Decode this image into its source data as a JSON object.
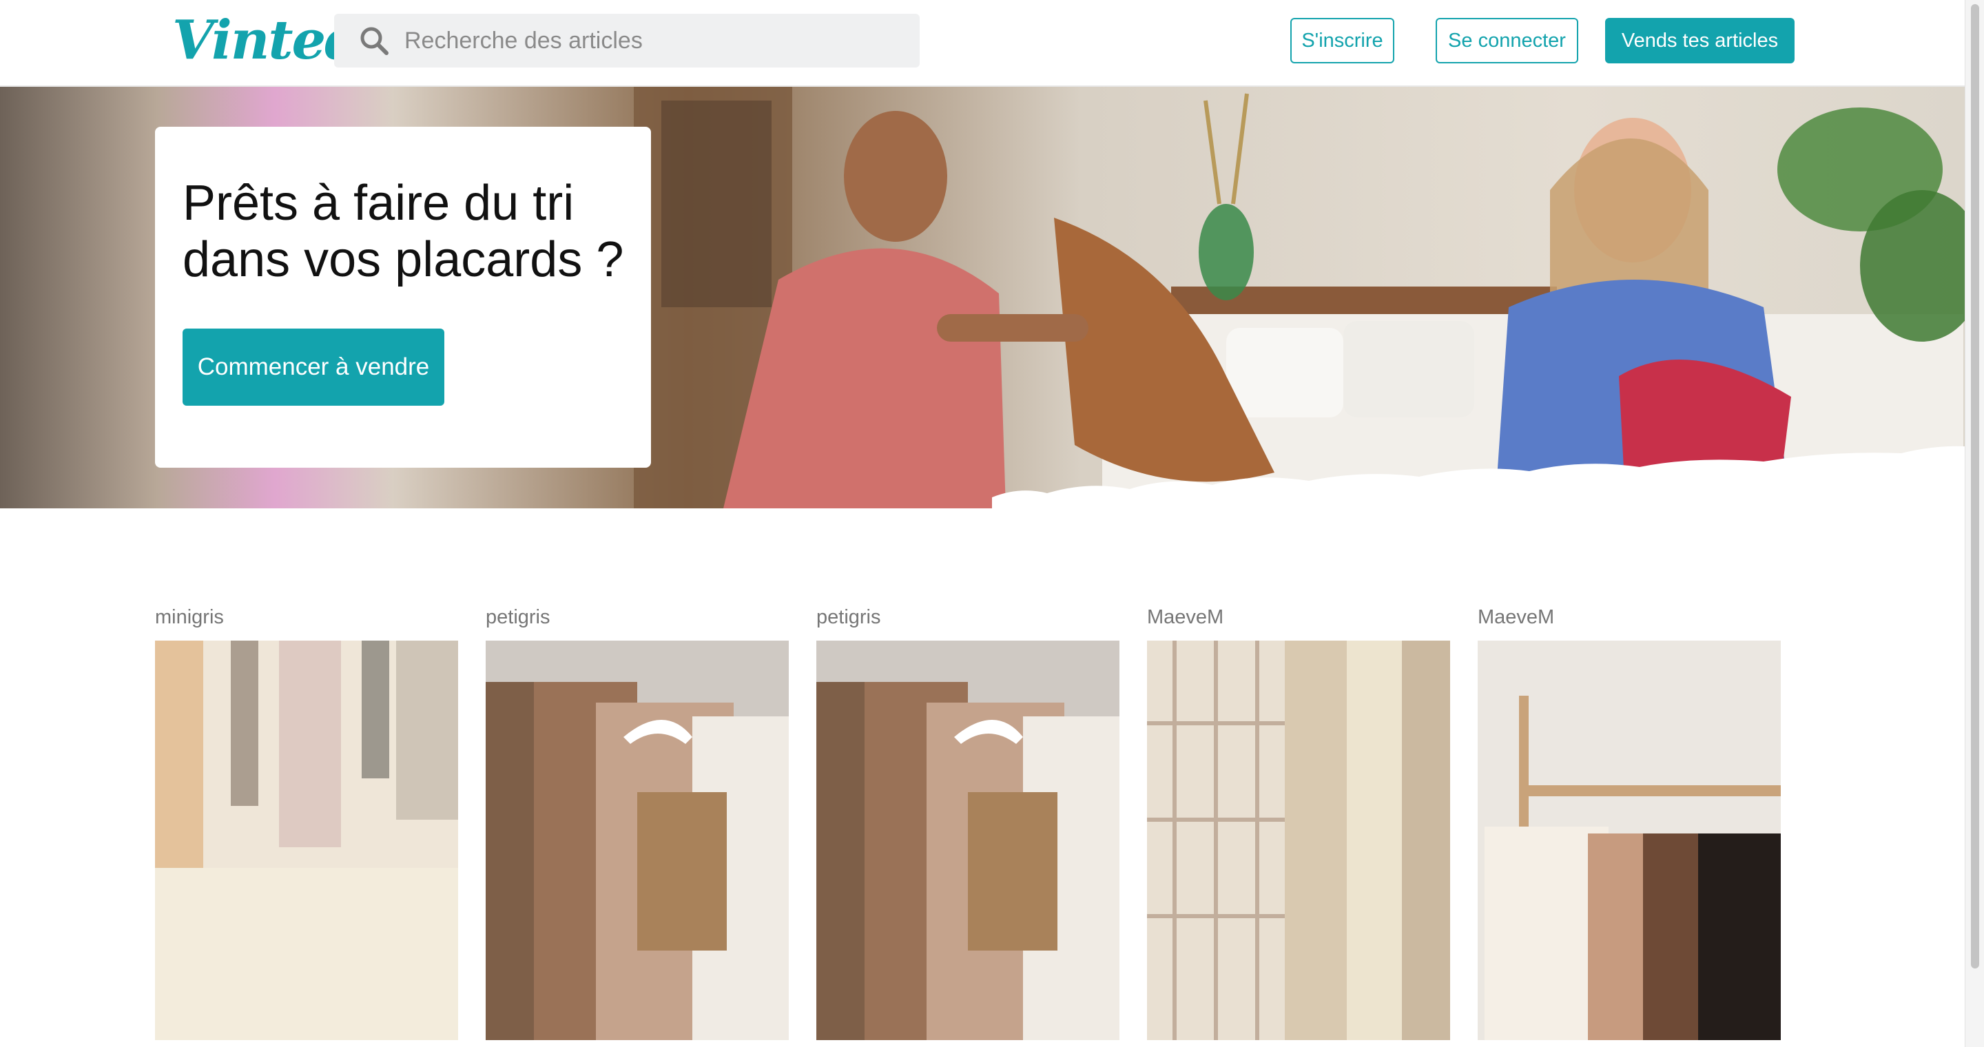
{
  "header": {
    "logo_text": "Vinted",
    "search": {
      "placeholder": "Recherche des articles",
      "value": ""
    },
    "signup_label": "S'inscrire",
    "login_label": "Se connecter",
    "sell_label": "Vends tes articles"
  },
  "hero": {
    "title": "Prêts à faire du tri dans vos placards ?",
    "cta_label": "Commencer à vendre"
  },
  "listings": [
    {
      "seller": "minigris",
      "photo": "abstract-painting"
    },
    {
      "seller": "petigris",
      "photo": "clothes-on-hangers"
    },
    {
      "seller": "petigris",
      "photo": "clothes-on-hangers"
    },
    {
      "seller": "MaeveM",
      "photo": "plaid-shirts"
    },
    {
      "seller": "MaeveM",
      "photo": "turtleneck-sweaters"
    }
  ],
  "colors": {
    "brand": "#13a3ad",
    "text": "#111111",
    "muted": "#767676",
    "search_bg": "#eff0f1"
  }
}
